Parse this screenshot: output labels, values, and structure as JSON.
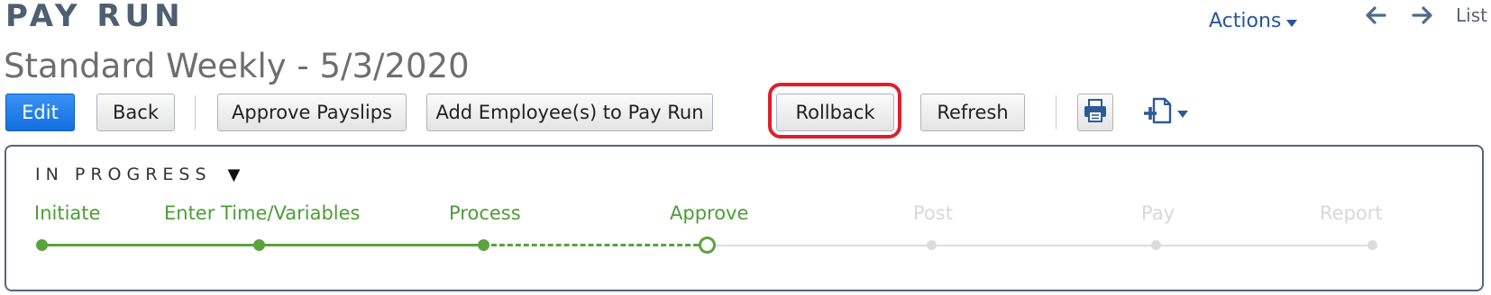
{
  "header": {
    "page_label": "PAY RUN",
    "record_title": "Standard Weekly - 5/3/2020",
    "nav": {
      "prev_icon": "left-arrow-icon",
      "next_icon": "right-arrow-icon",
      "list_label": "List"
    }
  },
  "toolbar": {
    "edit_label": "Edit",
    "back_label": "Back",
    "approve_payslips_label": "Approve Payslips",
    "add_employees_label": "Add Employee(s) to Pay Run",
    "rollback_label": "Rollback",
    "refresh_label": "Refresh",
    "print_icon": "print-icon",
    "new_document_icon": "new-document-icon",
    "actions_label": "Actions",
    "highlight_color": "#de1f2b"
  },
  "status": {
    "label": "IN PROGRESS",
    "caret": "▼",
    "steps": [
      {
        "label": "Initiate",
        "state": "done"
      },
      {
        "label": "Enter Time/Variables",
        "state": "done"
      },
      {
        "label": "Process",
        "state": "done"
      },
      {
        "label": "Approve",
        "state": "current"
      },
      {
        "label": "Post",
        "state": "pending"
      },
      {
        "label": "Pay",
        "state": "pending"
      },
      {
        "label": "Report",
        "state": "pending"
      }
    ]
  },
  "colors": {
    "complete": "#5ca23e",
    "pending": "#d8d8d8",
    "primary_button": "#1a73e8",
    "link": "#2a5599"
  }
}
